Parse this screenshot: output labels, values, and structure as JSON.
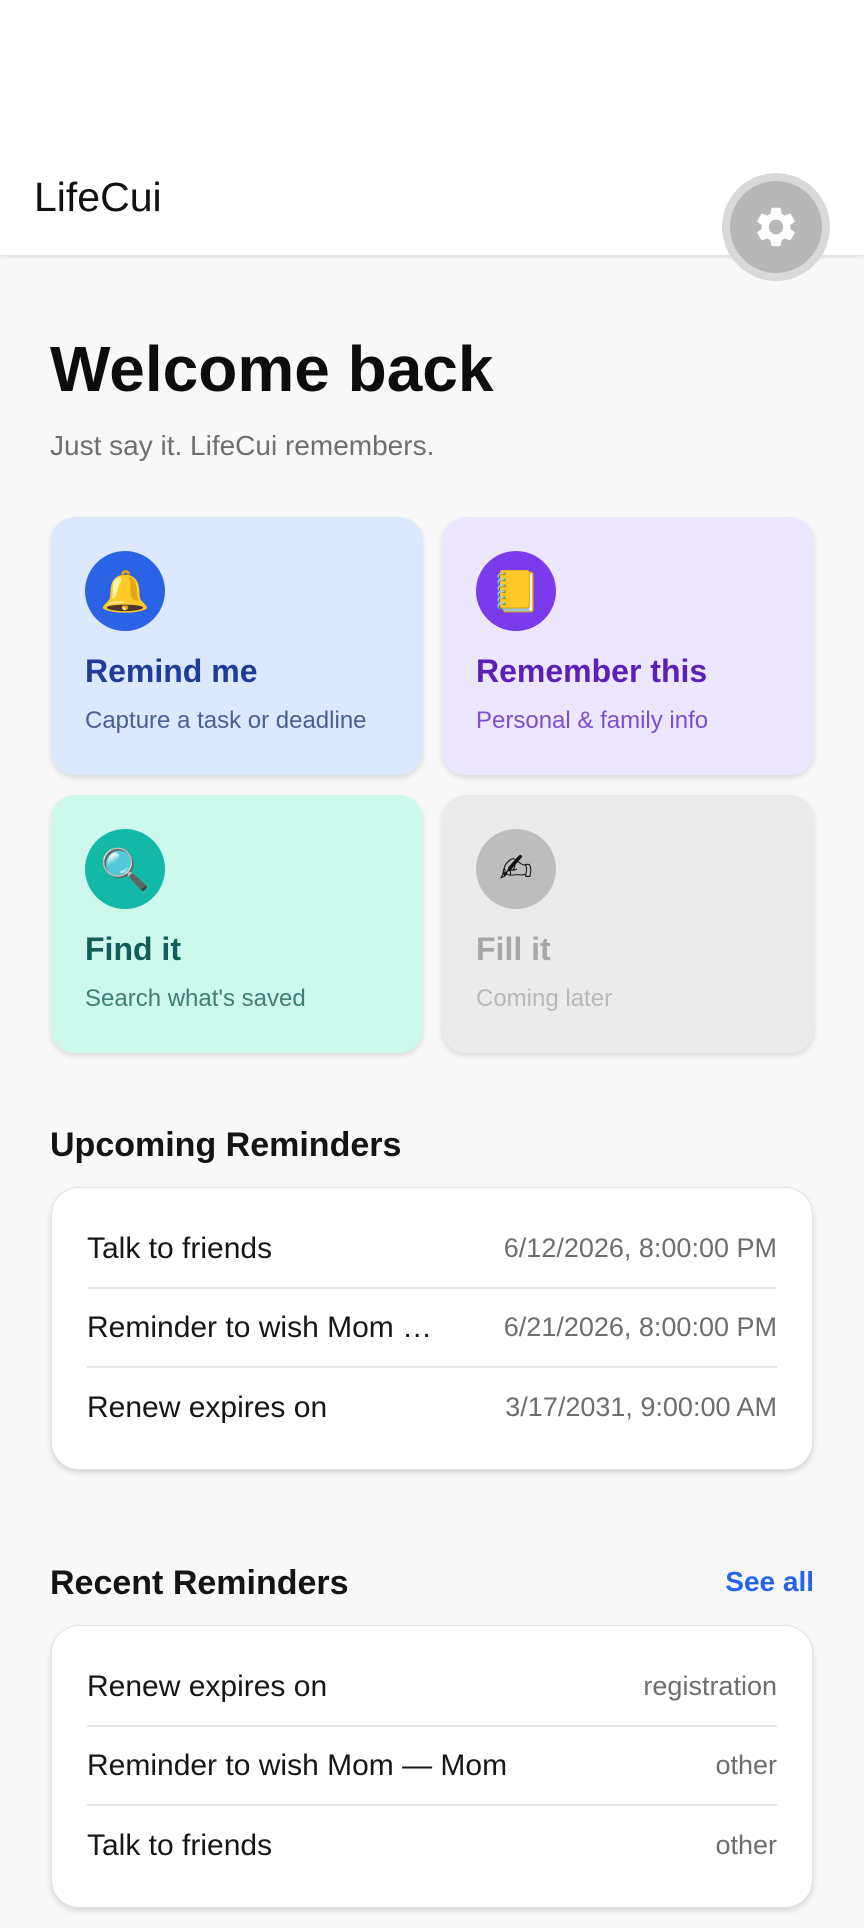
{
  "header": {
    "app_title": "LifeCui",
    "settings_icon": "gear-icon"
  },
  "hero": {
    "title": "Welcome back",
    "subtitle": "Just say it. LifeCui remembers."
  },
  "actions": [
    {
      "icon": "bell-icon",
      "glyph": "🔔",
      "title": "Remind me",
      "desc": "Capture a task or deadline"
    },
    {
      "icon": "notebook-icon",
      "glyph": "📒",
      "title": "Remember this",
      "desc": "Personal & family info"
    },
    {
      "icon": "magnifier-icon",
      "glyph": "🔍",
      "title": "Find it",
      "desc": "Search what's saved"
    },
    {
      "icon": "writing-hand-icon",
      "glyph": "✍",
      "title": "Fill it",
      "desc": "Coming later"
    }
  ],
  "upcoming": {
    "title": "Upcoming Reminders",
    "items": [
      {
        "name": "Talk to friends",
        "when": "6/12/2026, 8:00:00 PM"
      },
      {
        "name": "Reminder to wish Mom — Mom",
        "when": "6/21/2026, 8:00:00 PM"
      },
      {
        "name": "Renew expires on",
        "when": "3/17/2031, 9:00:00 AM"
      }
    ]
  },
  "recent": {
    "title": "Recent Reminders",
    "see_all": "See all",
    "items": [
      {
        "name": "Renew expires on",
        "category": "registration"
      },
      {
        "name": "Reminder to wish Mom — Mom",
        "category": "other"
      },
      {
        "name": "Talk to friends",
        "category": "other"
      }
    ]
  },
  "colors": {
    "accent": "#2563eb",
    "remind": "#2b63e6",
    "remember": "#7c3aed",
    "find": "#14b8a6",
    "disabled": "#bdbdbd"
  }
}
